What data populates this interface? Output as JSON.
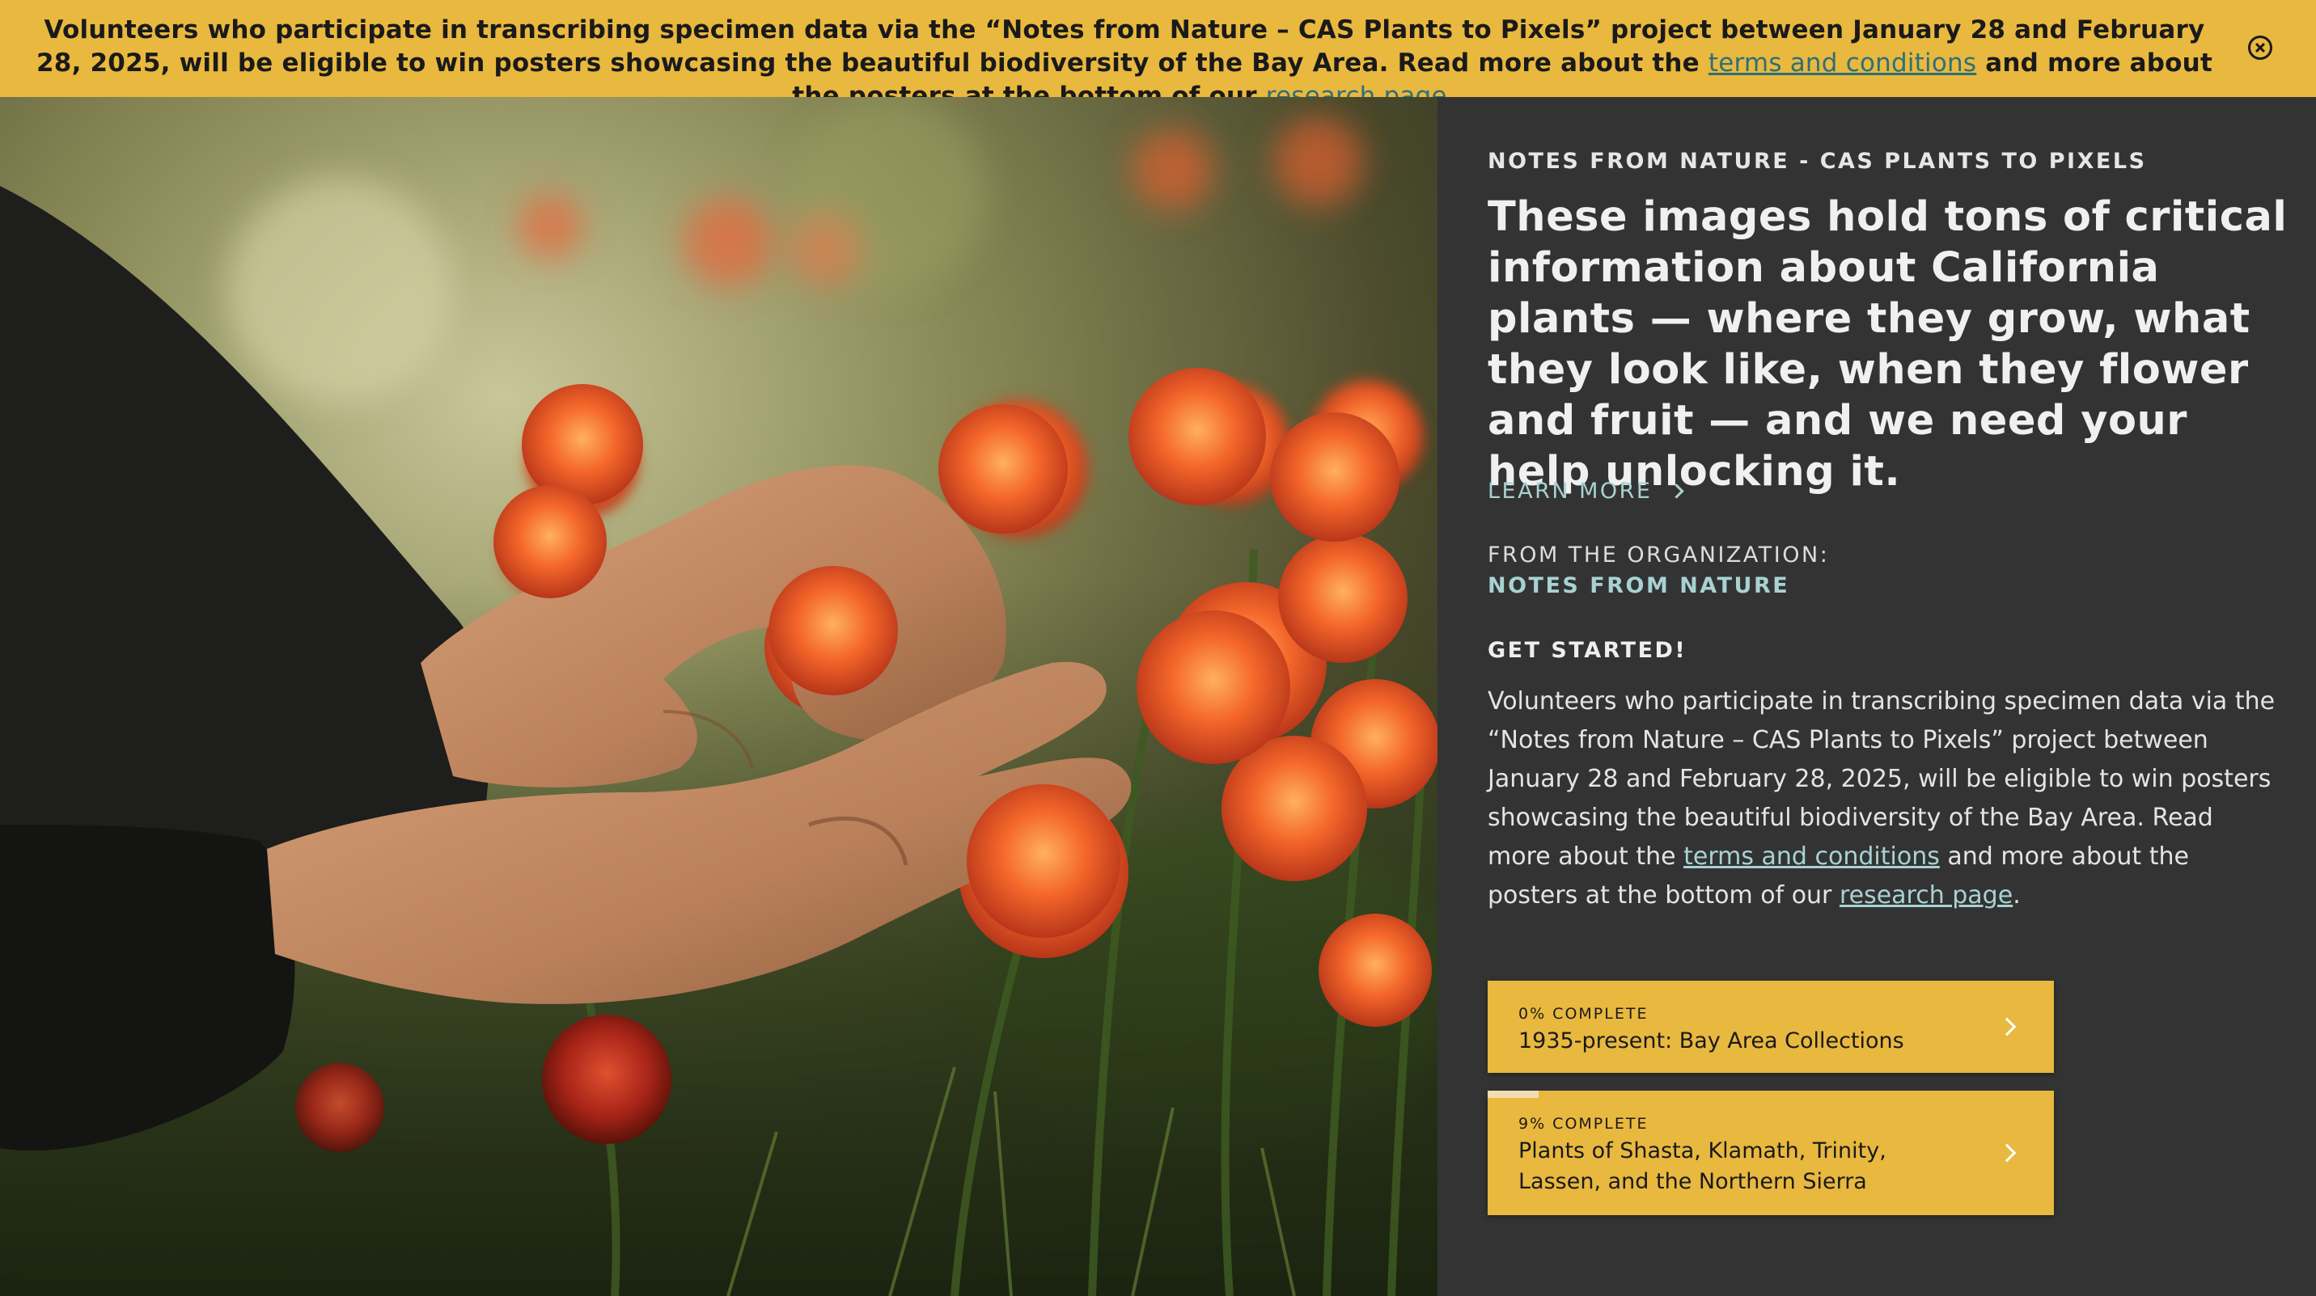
{
  "banner": {
    "text_part1": "Volunteers who participate in transcribing specimen data via the “Notes from Nature – CAS Plants to Pixels” project between January 28 and February 28, 2025, will be eligible to win posters showcasing the beautiful biodiversity of the Bay Area. Read more about the ",
    "terms_link": "terms and conditions",
    "text_part2": " and more about the posters at the bottom of our ",
    "research_link": "research page",
    "text_part3": ".",
    "close_icon": "close-circle-icon"
  },
  "hero": {
    "image_description_icon": "hero-photo"
  },
  "panel": {
    "eyebrow": "NOTES FROM NATURE - CAS PLANTS TO PIXELS",
    "headline": "These images hold tons of critical information about California plants — where they grow, what they look like, when they flower and fruit — and we need your help unlocking it.",
    "learn_more": "LEARN MORE",
    "org_label": "FROM THE ORGANIZATION:",
    "org_name": "NOTES FROM NATURE",
    "get_started": "GET STARTED!",
    "body_part1": "Volunteers who participate in transcribing specimen data via the “Notes from Nature – CAS Plants to Pixels” project between January 28 and February 28, 2025, will be eligible to win posters showcasing the beautiful biodiversity of the Bay Area. Read more about the ",
    "body_terms_link": "terms and conditions",
    "body_part2": " and more about the posters at the bottom of our ",
    "body_research_link": "research page",
    "body_part3": "."
  },
  "workflows": [
    {
      "status": "0% COMPLETE",
      "title": "1935-present: Bay Area Collections",
      "progress": 0
    },
    {
      "status": "9% COMPLETE",
      "title": "Plants of Shasta, Klamath, Trinity, Lassen, and the Northern Sierra",
      "progress": 9
    }
  ],
  "colors": {
    "banner_bg": "#e8b83f",
    "panel_bg": "#333333",
    "accent_link": "#a8d2d2",
    "card_bg": "#e8b83f"
  }
}
